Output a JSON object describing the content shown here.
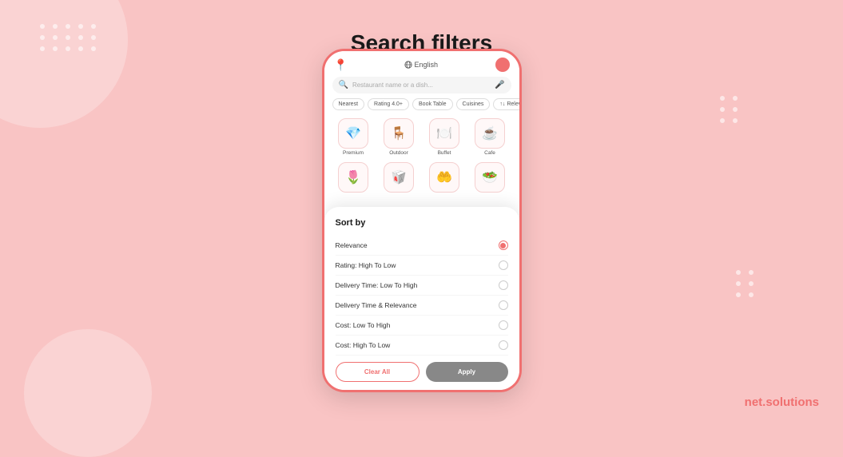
{
  "page": {
    "title": "Search filters",
    "background_color": "#f9c4c4"
  },
  "phone": {
    "topbar": {
      "lang_label": "English",
      "lang_icon": "globe"
    },
    "search": {
      "placeholder": "Restaurant name or a dish...",
      "mic_icon": "mic"
    },
    "filter_tabs": [
      {
        "label": "Nearest",
        "active": false
      },
      {
        "label": "Rating 4.0+",
        "active": false
      },
      {
        "label": "Book Table",
        "active": false
      },
      {
        "label": "Cuisines",
        "active": false
      },
      {
        "label": "↑↓ Relevance",
        "active": false
      }
    ],
    "categories": [
      {
        "label": "Premium",
        "icon": "💎"
      },
      {
        "label": "Outdoor",
        "icon": "🪑"
      },
      {
        "label": "Buffet",
        "icon": "🍽️"
      },
      {
        "label": "Cafe",
        "icon": "☕"
      }
    ],
    "categories_row2": [
      {
        "label": "",
        "icon": "🌷"
      },
      {
        "label": "",
        "icon": "🥡"
      },
      {
        "label": "",
        "icon": "🤲"
      },
      {
        "label": "",
        "icon": "🥗"
      }
    ]
  },
  "sort_sheet": {
    "title": "Sort by",
    "options": [
      {
        "label": "Relevance",
        "selected": true
      },
      {
        "label": "Rating: High To Low",
        "selected": false
      },
      {
        "label": "Delivery Time: Low To High",
        "selected": false
      },
      {
        "label": "Delivery Time & Relevance",
        "selected": false
      },
      {
        "label": "Cost: Low To High",
        "selected": false
      },
      {
        "label": "Cost: High To Low",
        "selected": false
      }
    ],
    "buttons": {
      "clear_label": "Clear All",
      "apply_label": "Apply"
    }
  },
  "brand": {
    "name_part1": "net",
    "name_part2": " solutions"
  }
}
